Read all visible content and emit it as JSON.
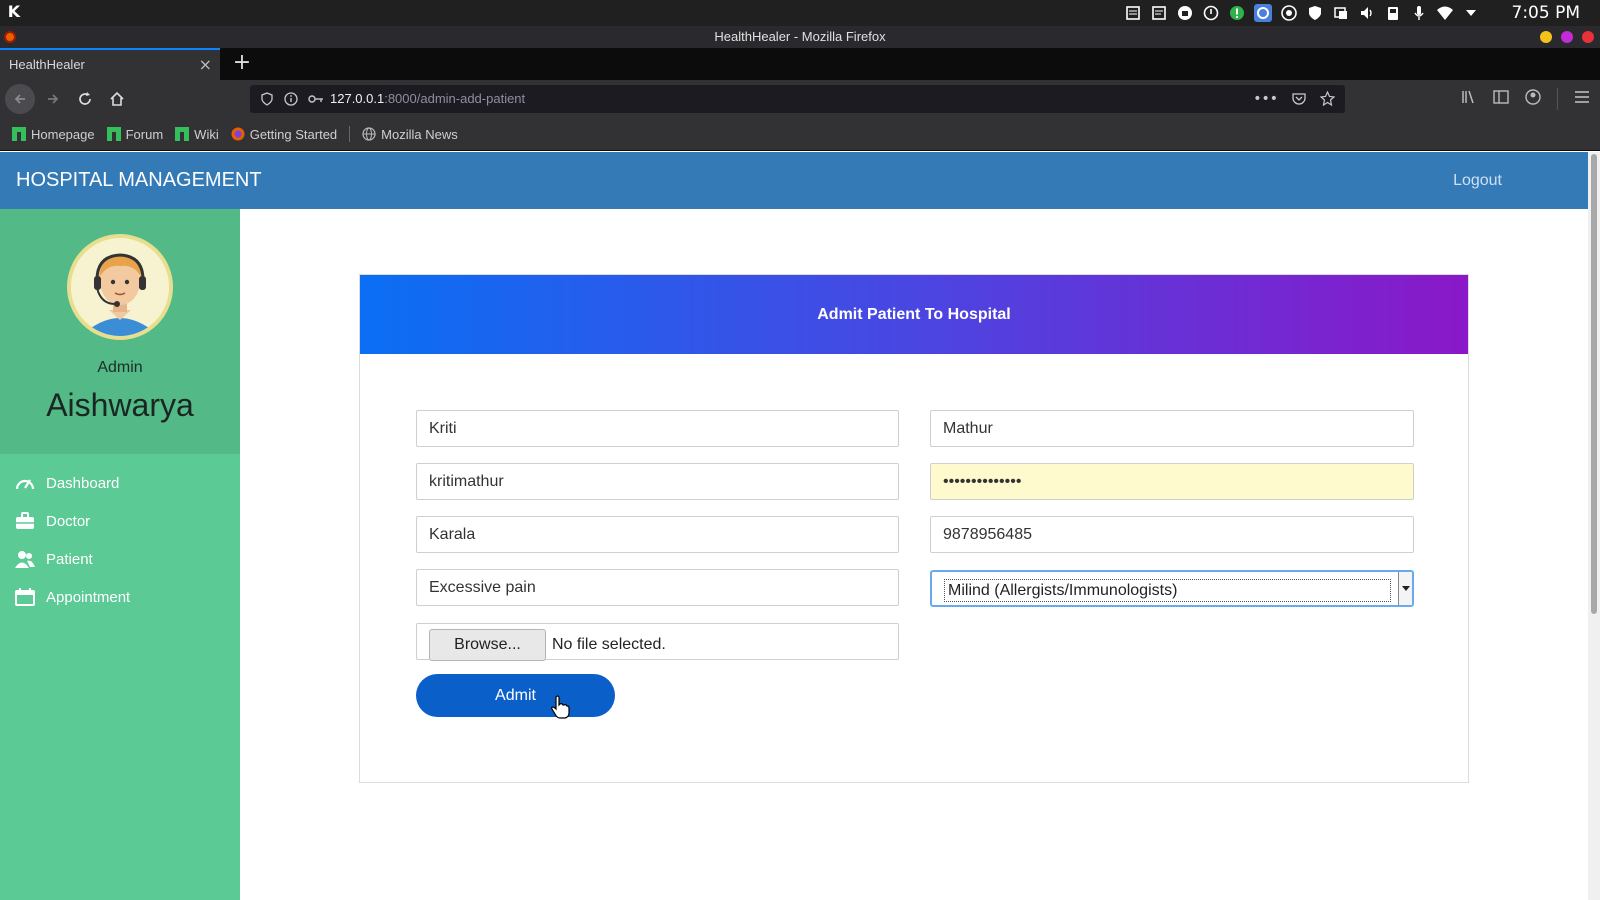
{
  "os": {
    "clock": "7:05 PM"
  },
  "window": {
    "title": "HealthHealer - Mozilla Firefox"
  },
  "browser": {
    "tab_title": "HealthHealer",
    "new_tab_glyph": "+",
    "url_host": "127.0.0.1",
    "url_path": ":8000/admin-add-patient",
    "bookmarks": [
      "Homepage",
      "Forum",
      "Wiki",
      "Getting Started",
      "Mozilla News"
    ]
  },
  "app": {
    "brand": "HOSPITAL MANAGEMENT",
    "logout": "Logout",
    "profile": {
      "role": "Admin",
      "name": "Aishwarya"
    },
    "menu": [
      "Dashboard",
      "Doctor",
      "Patient",
      "Appointment"
    ]
  },
  "form": {
    "heading": "Admit Patient To Hospital",
    "first_name": "Kriti",
    "last_name": "Mathur",
    "username": "kritimathur",
    "password_mask": "••••••••••••••",
    "address": "Karala",
    "mobile": "9878956485",
    "symptoms": "Excessive pain",
    "doctor": "Milind (Allergists/Immunologists)",
    "browse_label": "Browse...",
    "file_status": "No file selected.",
    "submit_label": "Admit"
  },
  "colors": {
    "header": "#337ab7",
    "sidebar": "#5cca95",
    "profile_bg": "#52b987",
    "gradient_start": "#0a6ff4",
    "gradient_end": "#8a18c8",
    "admit_button": "#0b5fc9"
  }
}
